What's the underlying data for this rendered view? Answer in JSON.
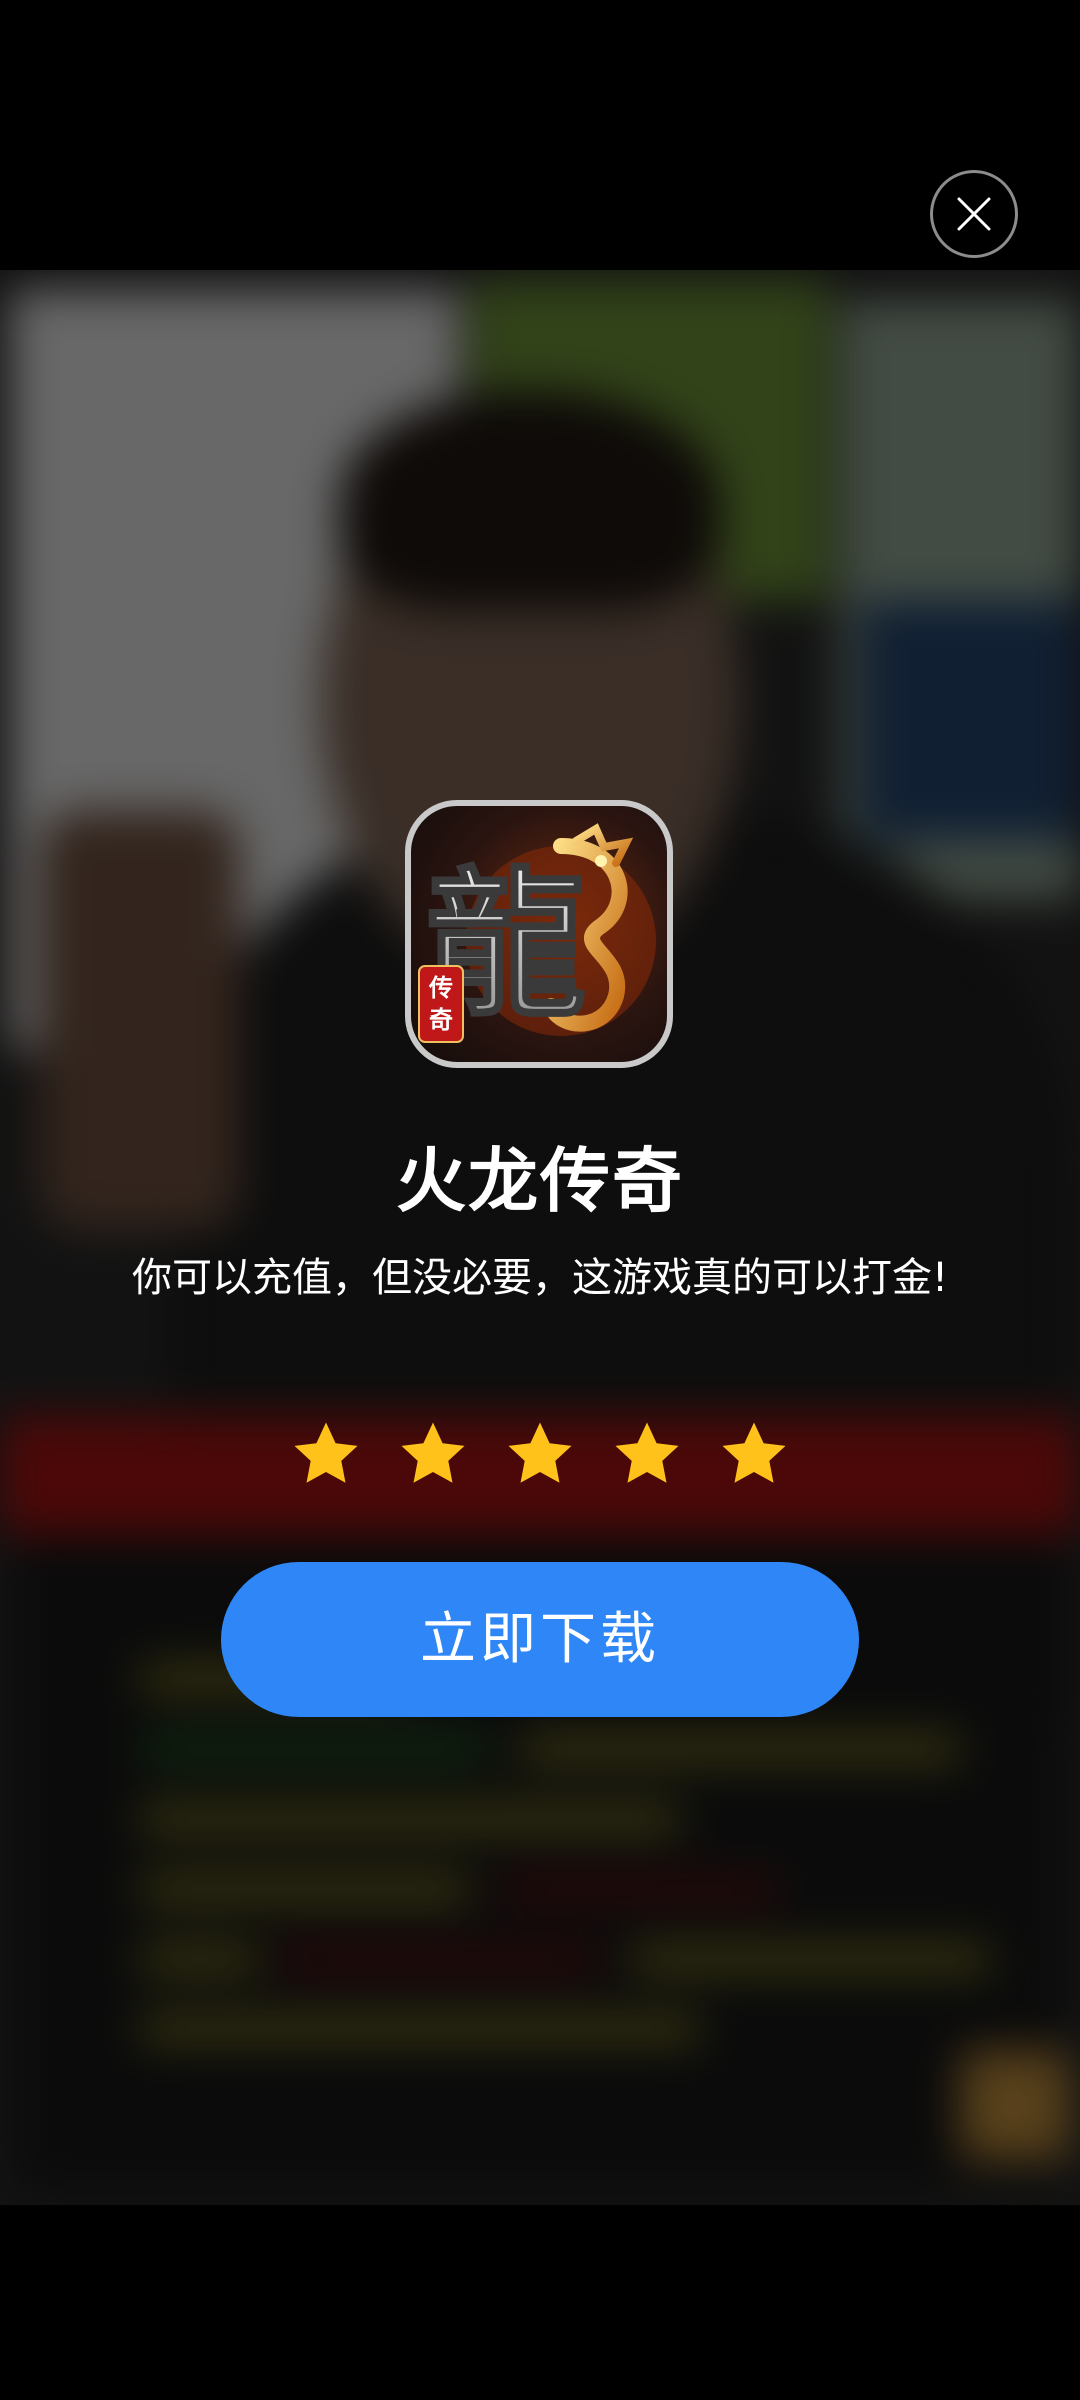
{
  "app": {
    "name": "火龙传奇",
    "description": "你可以充值，但没必要，这游戏真的可以打金!",
    "icon_glyph_main": "龍",
    "icon_badge": "传奇",
    "rating": 5,
    "rating_max": 5
  },
  "actions": {
    "download_label": "立即下载",
    "close_icon": "close-icon"
  },
  "colors": {
    "accent": "#2f86f6",
    "star": "#ffc21a",
    "overlay": "#000000"
  }
}
